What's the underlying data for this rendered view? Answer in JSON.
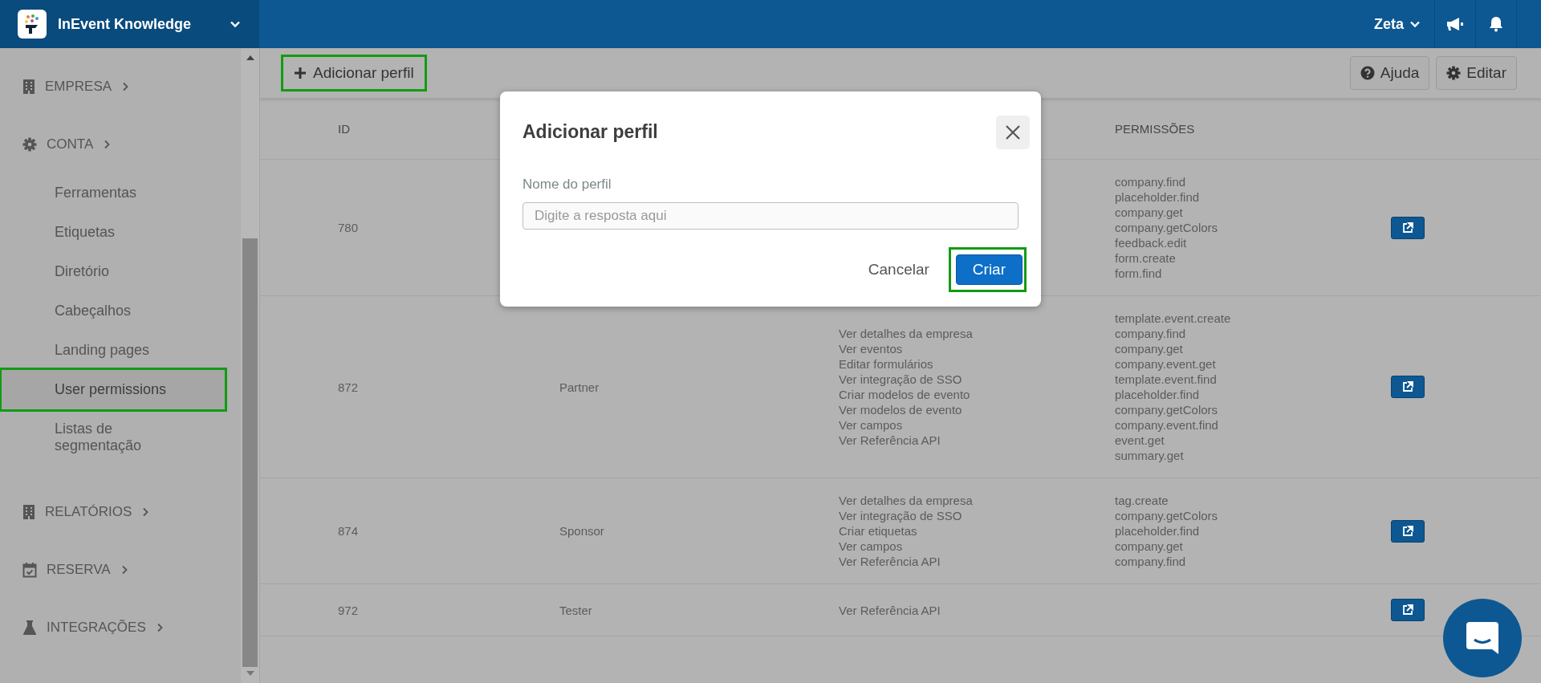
{
  "topbar": {
    "workspace": "InEvent Knowledge",
    "user": "Zeta"
  },
  "sidebar": {
    "sections": [
      {
        "label": "EMPRESA"
      },
      {
        "label": "CONTA",
        "children": [
          {
            "label": "Ferramentas",
            "selected": false,
            "highlighted": false
          },
          {
            "label": "Etiquetas",
            "selected": false,
            "highlighted": false
          },
          {
            "label": "Diretório",
            "selected": false,
            "highlighted": false
          },
          {
            "label": "Cabeçalhos",
            "selected": false,
            "highlighted": false
          },
          {
            "label": "Landing pages",
            "selected": false,
            "highlighted": false
          },
          {
            "label": "User permissions",
            "selected": true,
            "highlighted": true
          },
          {
            "label": "Listas de segmentação",
            "selected": false,
            "highlighted": false
          }
        ]
      },
      {
        "label": "RELATÓRIOS"
      },
      {
        "label": "RESERVA"
      },
      {
        "label": "INTEGRAÇÕES"
      }
    ]
  },
  "toolbar": {
    "add_button": {
      "label": "Adicionar perfil",
      "highlighted": true
    },
    "help_button": "Ajuda",
    "edit_button": "Editar"
  },
  "table": {
    "header": {
      "id": "ID",
      "permissions": "PERMISSÕES"
    },
    "rows": [
      {
        "id": "780",
        "permissions": [
          "company.find",
          "placeholder.find",
          "company.get",
          "company.getColors",
          "feedback.edit",
          "form.create",
          "form.find"
        ]
      },
      {
        "id": "872",
        "name": "Partner",
        "descriptions": [
          "Ver detalhes da empresa",
          "Ver eventos",
          "Editar formulários",
          "Ver integração de SSO",
          "Criar modelos de evento",
          "Ver modelos de evento",
          "Ver campos",
          "Ver Referência API"
        ],
        "permissions": [
          "template.event.create",
          "company.find",
          "company.get",
          "company.event.get",
          "template.event.find",
          "placeholder.find",
          "company.getColors",
          "company.event.find",
          "event.get",
          "summary.get"
        ]
      },
      {
        "id": "874",
        "name": "Sponsor",
        "descriptions": [
          "Ver detalhes da empresa",
          "Ver integração de SSO",
          "Criar etiquetas",
          "Ver campos",
          "Ver Referência API"
        ],
        "permissions": [
          "tag.create",
          "company.getColors",
          "placeholder.find",
          "company.get",
          "company.find"
        ]
      },
      {
        "id": "972",
        "name": "Tester",
        "descriptions": [
          "Ver Referência API"
        ]
      }
    ]
  },
  "modal": {
    "title": "Adicionar perfil",
    "field_label": "Nome do perfil",
    "placeholder": "Digite a resposta aqui",
    "cancel": "Cancelar",
    "submit": {
      "label": "Criar",
      "highlighted": true
    }
  }
}
